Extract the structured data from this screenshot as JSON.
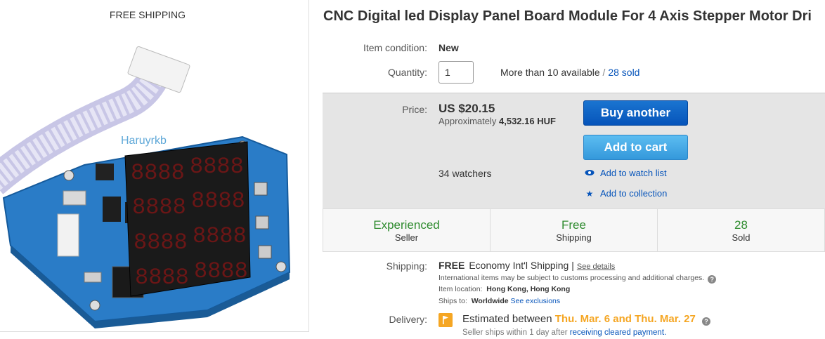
{
  "image_panel": {
    "caption": "FREE SHIPPING",
    "watermark": "Haruyrkb"
  },
  "listing": {
    "title": "CNC Digital led Display Panel Board Module For 4 Axis Stepper Motor Dri",
    "condition_label": "Item condition:",
    "condition_value": "New",
    "quantity_label": "Quantity:",
    "quantity_value": "1",
    "availability": "More than 10 available",
    "availability_sep": "/",
    "sold_link": "28 sold"
  },
  "price": {
    "label": "Price:",
    "value": "US $20.15",
    "approx_prefix": "Approximately",
    "approx_value": "4,532.16 HUF",
    "watchers": "34 watchers",
    "buy_button": "Buy another",
    "cart_button": "Add to cart",
    "watch_link": "Add to watch list",
    "collection_link": "Add to collection"
  },
  "stats": [
    {
      "top": "Experienced",
      "bottom": "Seller"
    },
    {
      "top": "Free",
      "bottom": "Shipping"
    },
    {
      "top": "28",
      "bottom": "Sold"
    }
  ],
  "shipping": {
    "label": "Shipping:",
    "free": "FREE",
    "method": "Economy Int'l Shipping |",
    "details_link": "See details",
    "intl_note": "International items may be subject to customs processing and additional charges.",
    "location_label": "Item location:",
    "location_value": "Hong Kong, Hong Kong",
    "ships_to_label": "Ships to:",
    "ships_to_value": "Worldwide",
    "exclusions_link": "See exclusions"
  },
  "delivery": {
    "label": "Delivery:",
    "estimate_prefix": "Estimated between",
    "date_range": "Thu. Mar. 6 and Thu. Mar. 27",
    "note_prefix": "Seller ships within 1 day after",
    "note_link": "receiving cleared payment."
  },
  "colors": {
    "link": "#0654ba",
    "buy_button": "#0654ba",
    "cart_button": "#3498db",
    "stat_green": "#2e8b2e",
    "delivery_orange": "#f5a623"
  },
  "icons": {
    "watch": "eye-icon",
    "collection": "star-icon",
    "help": "question-icon",
    "delivery": "flag-icon"
  }
}
